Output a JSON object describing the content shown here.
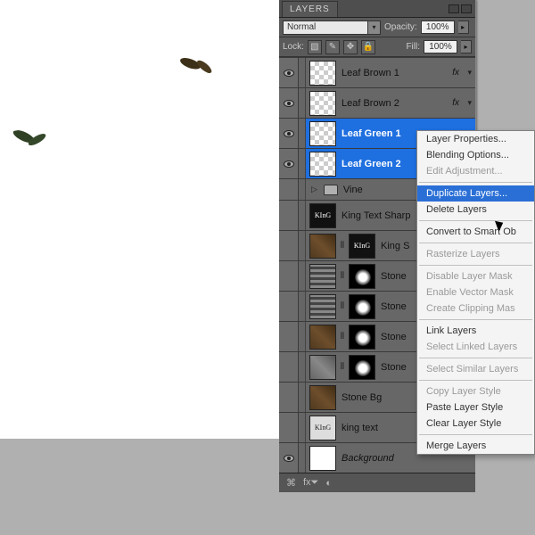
{
  "panel": {
    "tabs": {
      "layers": "LAYERS"
    },
    "blendMode": "Normal",
    "opacityLabel": "Opacity:",
    "opacityValue": "100%",
    "lockLabel": "Lock:",
    "fillLabel": "Fill:",
    "fillValue": "100%"
  },
  "layers": {
    "leafBrown1": "Leaf Brown 1",
    "leafBrown2": "Leaf Brown 2",
    "leafGreen1": "Leaf Green 1",
    "leafGreen2": "Leaf Green 2",
    "vine": "Vine",
    "kingTextSharp": "King Text Sharp",
    "kingS": "King S",
    "stone1": "Stone",
    "stone2": "Stone",
    "stone3": "Stone",
    "stone4": "Stone",
    "stoneBg": "Stone Bg",
    "kingText": "king text",
    "background": "Background",
    "fxLabel": "fx",
    "arrow": "▾"
  },
  "contextMenu": {
    "layerProperties": "Layer Properties...",
    "blendingOptions": "Blending Options...",
    "editAdjustment": "Edit Adjustment...",
    "duplicateLayers": "Duplicate Layers...",
    "deleteLayers": "Delete Layers",
    "convertSmart": "Convert to Smart Ob",
    "rasterize": "Rasterize Layers",
    "disableMask": "Disable Layer Mask",
    "enableVector": "Enable Vector Mask",
    "createClipping": "Create Clipping Mas",
    "linkLayers": "Link Layers",
    "selectLinked": "Select Linked Layers",
    "selectSimilar": "Select Similar Layers",
    "copyStyle": "Copy Layer Style",
    "pasteStyle": "Paste Layer Style",
    "clearStyle": "Clear Layer Style",
    "mergeLayers": "Merge Layers"
  }
}
